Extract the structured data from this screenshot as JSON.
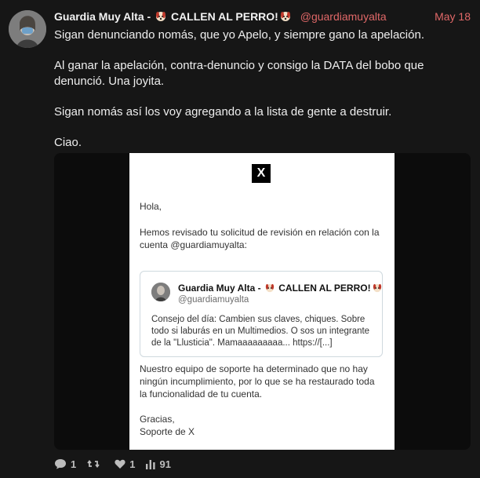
{
  "post": {
    "author_name": "Guardia Muy Alta - ",
    "author_tag": "CALLEN AL PERRO!",
    "handle": "@guardiamuyalta",
    "date": "May 18",
    "paragraphs": [
      "Sigan denunciando nomás, que yo Apelo, y siempre gano la apelación.",
      "Al ganar la apelación, contra-denuncio y consigo la DATA del bobo que denunció. Una joyita.",
      "Sigan nomás así los voy agregando a la lista de gente a destruir.",
      "Ciao."
    ]
  },
  "email": {
    "logo": "X",
    "greeting": "Hola,",
    "intro": "Hemos revisado tu solicitud de revisión en relación con la cuenta @guardiamuyalta:",
    "quoted": {
      "name": "Guardia Muy Alta - ",
      "tag": "CALLEN AL PERRO!",
      "handle": "@guardiamuyalta",
      "text": "Consejo del día: Cambien sus claves, chiques. Sobre todo si laburás en un Multimedios. O sos un integrante de la \"Llusticia\". Mamaaaaaaaaa... https://[...]"
    },
    "decision": "Nuestro equipo de soporte ha determinado que no hay ningún incumplimiento, por lo que se ha restaurado toda la funcionalidad de tu cuenta.",
    "thanks": "Gracias,",
    "signature": "Soporte de X"
  },
  "actions": {
    "replies": "1",
    "reposts_icon": "repost-icon",
    "likes": "1",
    "views": "91"
  },
  "colors": {
    "background": "#161616",
    "accent": "#e06868"
  }
}
